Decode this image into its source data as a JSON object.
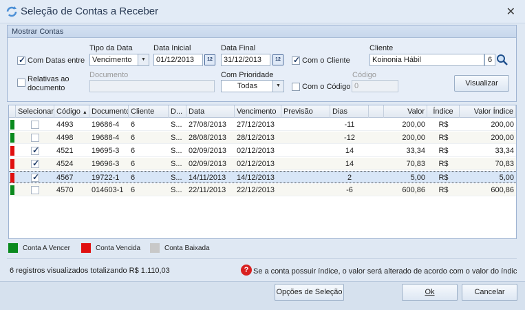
{
  "window": {
    "title": "Seleção de Contas a Receber",
    "close_icon": "close-icon"
  },
  "panel": {
    "title": "Mostrar Contas",
    "com_datas_entre": {
      "label": "Com Datas entre",
      "checked": true
    },
    "relativas": {
      "label_line1": "Relativas ao",
      "label_line2": "documento",
      "checked": false
    },
    "tipo_data": {
      "label": "Tipo da Data",
      "value": "Vencimento"
    },
    "data_inicial": {
      "label": "Data Inicial",
      "value": "01/12/2013"
    },
    "data_final": {
      "label": "Data Final",
      "value": "31/12/2013"
    },
    "calendar_badge": "12",
    "com_o_cliente": {
      "label": "Com o Cliente",
      "checked": true
    },
    "cliente": {
      "label": "Cliente",
      "value": "Koinonia Hábil",
      "code": "6"
    },
    "documento": {
      "label": "Documento",
      "value": ""
    },
    "com_prioridade": {
      "label": "Com Prioridade",
      "value": "Todas"
    },
    "com_o_codigo": {
      "label": "Com o Código",
      "checked": false
    },
    "codigo": {
      "label": "Código",
      "value": "0"
    },
    "visualizar_label": "Visualizar"
  },
  "grid": {
    "columns": [
      "Selecionar",
      "Código",
      "Documento",
      "Cliente",
      "D...",
      "Data",
      "Vencimento",
      "Previsão",
      "Dias",
      "",
      "Valor",
      "Índice",
      "Valor Índice"
    ],
    "rows": [
      {
        "status": "green",
        "selected": false,
        "codigo": "4493",
        "documento": "19686-4",
        "cliente": "6",
        "d": "S...",
        "data": "27/08/2013",
        "vencimento": "27/12/2013",
        "previsao": "",
        "dias": "-11",
        "valor": "200,00",
        "indice": "R$",
        "valor_indice": "200,00"
      },
      {
        "status": "green",
        "selected": false,
        "codigo": "4498",
        "documento": "19688-4",
        "cliente": "6",
        "d": "S...",
        "data": "28/08/2013",
        "vencimento": "28/12/2013",
        "previsao": "",
        "dias": "-12",
        "valor": "200,00",
        "indice": "R$",
        "valor_indice": "200,00"
      },
      {
        "status": "red",
        "selected": true,
        "codigo": "4521",
        "documento": "19695-3",
        "cliente": "6",
        "d": "S...",
        "data": "02/09/2013",
        "vencimento": "02/12/2013",
        "previsao": "",
        "dias": "14",
        "valor": "33,34",
        "indice": "R$",
        "valor_indice": "33,34"
      },
      {
        "status": "red",
        "selected": true,
        "codigo": "4524",
        "documento": "19696-3",
        "cliente": "6",
        "d": "S...",
        "data": "02/09/2013",
        "vencimento": "02/12/2013",
        "previsao": "",
        "dias": "14",
        "valor": "70,83",
        "indice": "R$",
        "valor_indice": "70,83"
      },
      {
        "status": "red",
        "selected": true,
        "codigo": "4567",
        "documento": "19722-1",
        "cliente": "6",
        "d": "S...",
        "data": "14/11/2013",
        "vencimento": "14/12/2013",
        "previsao": "",
        "dias": "2",
        "valor": "5,00",
        "indice": "R$",
        "valor_indice": "5,00"
      },
      {
        "status": "green",
        "selected": false,
        "codigo": "4570",
        "documento": "014603-1",
        "cliente": "6",
        "d": "S...",
        "data": "22/11/2013",
        "vencimento": "22/12/2013",
        "previsao": "",
        "dias": "-6",
        "valor": "600,86",
        "indice": "R$",
        "valor_indice": "600,86"
      }
    ]
  },
  "legend": {
    "a_vencer": {
      "label": "Conta A Vencer",
      "color": "#0a8a1e"
    },
    "vencida": {
      "label": "Conta Vencida",
      "color": "#e01010"
    },
    "baixada": {
      "label": "Conta Baixada",
      "color": "#c8c8c8"
    }
  },
  "status_text": "6 registros visualizados totalizando R$ 1.110,03",
  "help_text": "Se a conta possuir índice, o valor será alterado de acordo com o valor do índice no dia",
  "help_icon_glyph": "?",
  "buttons": {
    "opcoes": "Opções de Seleção",
    "ok": "Ok",
    "cancelar": "Cancelar"
  }
}
